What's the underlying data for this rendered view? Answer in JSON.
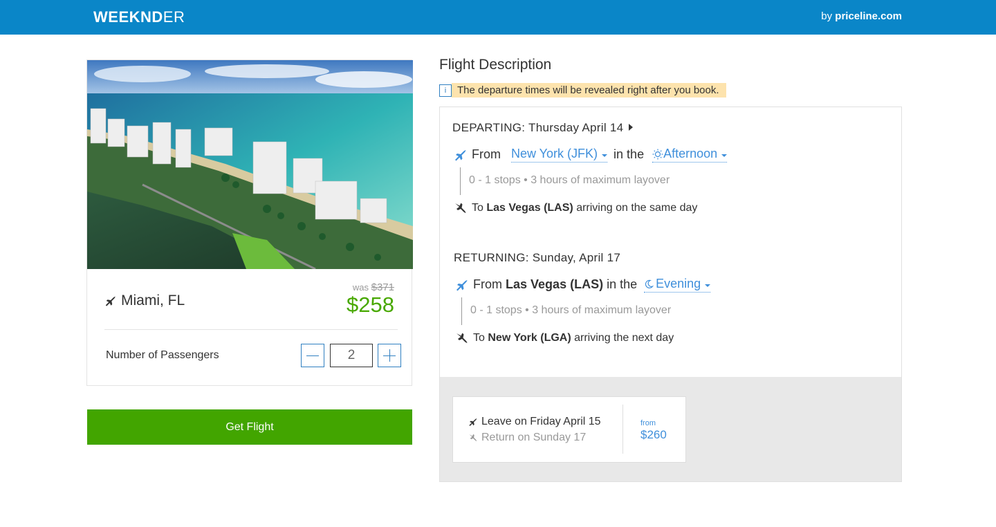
{
  "header": {
    "logo_bold": "WEEKND",
    "logo_light": "ER",
    "by_prefix": "by",
    "by_brand": "priceline.com"
  },
  "deal": {
    "destination": "Miami, FL",
    "was_label": "was",
    "was_price": "$371",
    "price": "$258",
    "passengers_label": "Number of Passengers",
    "passengers_value": "2",
    "cta_label": "Get Flight"
  },
  "flight": {
    "title": "Flight Description",
    "notice": "The departure times will be revealed right after you book.",
    "notice_icon": "i",
    "departing": {
      "title": "DEPARTING: Thursday April 14",
      "from_label": "From",
      "origin": "New York (JFK)",
      "in_the": "in the",
      "time_of_day": "Afternoon",
      "stops": "0 - 1 stops • 3 hours of maximum layover",
      "to_label": "To",
      "destination": "Las Vegas (LAS)",
      "arrival_note": "arriving on the same day"
    },
    "returning": {
      "title": "RETURNING: Sunday, April 17",
      "from_label": "From",
      "origin": "Las Vegas (LAS)",
      "in_the": "in the",
      "time_of_day": "Evening",
      "stops": "0 - 1 stops • 3 hours of maximum layover",
      "to_label": "To",
      "destination": "New York (LGA)",
      "arrival_note": "arriving the next day"
    },
    "alternative": {
      "leave": "Leave on Friday April 15",
      "return": "Return on Sunday 17",
      "from_label": "from",
      "price": "$260"
    }
  },
  "colors": {
    "header_bg": "#0a86c8",
    "price_green": "#48a800",
    "cta_green": "#42a500",
    "link_blue": "#3f8fdb",
    "notice_bg": "#fde3ad"
  },
  "icons": {
    "plane_depart": "airplane-takeoff-icon",
    "plane_land": "airplane-landing-icon",
    "sun": "sun-icon",
    "moon": "moon-icon",
    "info": "info-icon",
    "minus": "minus-icon",
    "plus": "plus-icon"
  }
}
